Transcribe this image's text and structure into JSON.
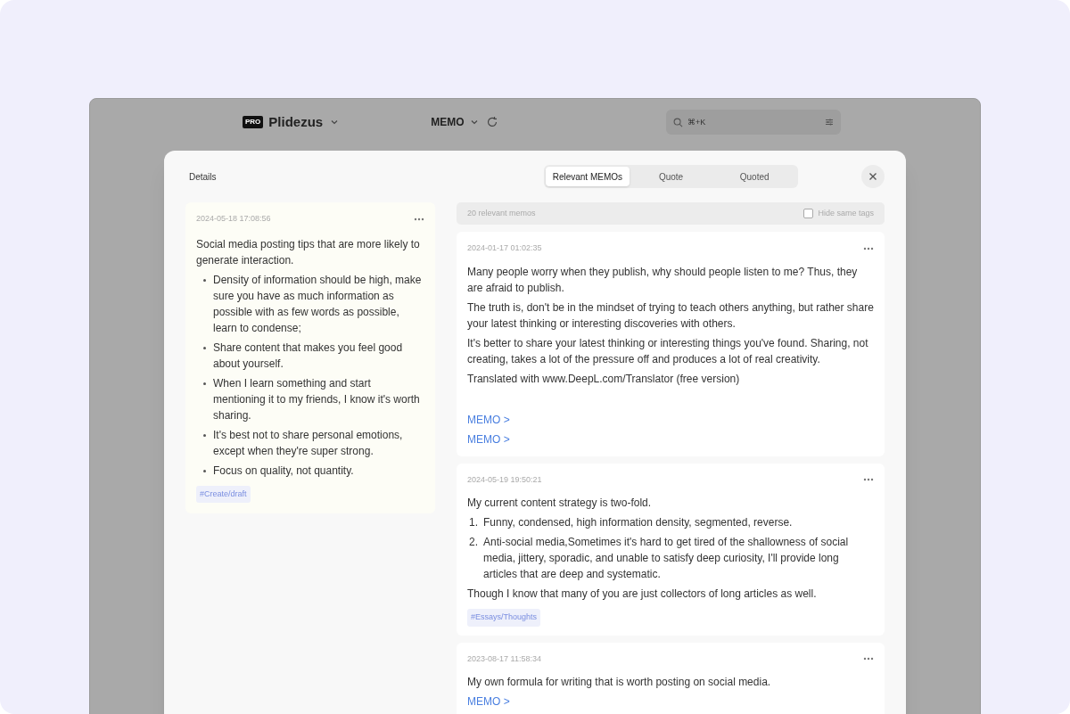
{
  "app_header": {
    "badge": "PRO",
    "workspace": "Plidezus",
    "view": "MEMO",
    "search": {
      "placeholder": "⌘+K"
    }
  },
  "dialog": {
    "title": "Details",
    "tabs": [
      {
        "label": "Relevant MEMOs",
        "selected": true
      },
      {
        "label": "Quote",
        "selected": false
      },
      {
        "label": "Quoted",
        "selected": false
      }
    ],
    "detail": {
      "time": "2024-05-18 17:08:56",
      "blocks": [
        {
          "kind": "paragraph",
          "text": "Social media posting tips that are more likely to generate interaction."
        },
        {
          "kind": "bullets",
          "items": [
            "Density of information should be high, make sure you have as much information as possible with as few words as possible, learn to condense;",
            "Share content that makes you feel good about yourself.",
            "When I learn something and start mentioning it to my friends, I know it's worth sharing.",
            "It's best not to share personal emotions, except when they're super strong.",
            "Focus on quality, not quantity."
          ]
        }
      ],
      "tags": [
        "#Create/draft"
      ]
    },
    "relevant": {
      "count": "20 relevant memos",
      "hide_same_tags": {
        "label": "Hide same tags",
        "checked": false
      },
      "memos": [
        {
          "time": "2024-01-17 01:02:35",
          "blocks": [
            {
              "kind": "paragraph",
              "text": "Many people worry when they publish, why should people listen to me? Thus, they are afraid to publish."
            },
            {
              "kind": "paragraph",
              "text": "The truth is, don't be in the mindset of trying to teach others anything, but rather share your latest thinking or interesting discoveries with others."
            },
            {
              "kind": "paragraph",
              "text": "It's better to share your latest thinking or interesting things you've found. Sharing, not creating, takes a lot of the pressure off and produces a lot of real creativity."
            },
            {
              "kind": "paragraph",
              "text": "Translated with www.DeepL.com/Translator (free version)"
            },
            {
              "kind": "spacer"
            },
            {
              "kind": "link",
              "text": "MEMO >"
            },
            {
              "kind": "link",
              "text": "MEMO >"
            }
          ]
        },
        {
          "time": "2024-05-19 19:50:21",
          "blocks": [
            {
              "kind": "paragraph",
              "text": "My current content strategy is two-fold."
            },
            {
              "kind": "numbered",
              "items": [
                {
                  "number": "1.",
                  "text": "Funny, condensed, high information density, segmented, reverse."
                },
                {
                  "number": "2.",
                  "text": "Anti-social media,Sometimes it's hard to get tired of the shallowness of social media, jittery, sporadic, and unable to satisfy deep curiosity, I'll provide long articles that are deep and systematic."
                }
              ]
            },
            {
              "kind": "paragraph",
              "text": "Though I know that many of you are just collectors of long articles as well."
            }
          ],
          "tags": [
            "#Essays/Thoughts"
          ]
        },
        {
          "time": "2023-08-17 11:58:34",
          "blocks": [
            {
              "kind": "paragraph",
              "text": "My own formula for writing that is worth posting on social media."
            },
            {
              "kind": "link",
              "text": "MEMO >"
            }
          ]
        }
      ]
    }
  }
}
